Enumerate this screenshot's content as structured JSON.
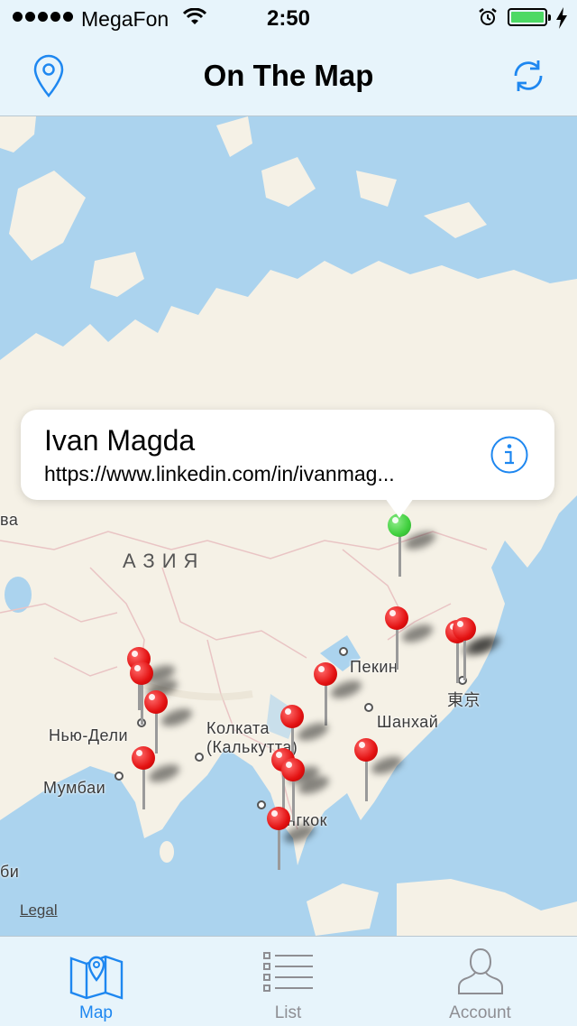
{
  "status_bar": {
    "carrier": "MegaFon",
    "time": "2:50",
    "battery_level": 1.0,
    "battery_color": "#4cd964",
    "icons": [
      "signal-dots",
      "wifi-icon",
      "alarm-icon",
      "battery-icon",
      "charging-bolt-icon"
    ]
  },
  "nav": {
    "title": "On The Map",
    "left_icon": "location-pin-icon",
    "right_icon": "refresh-icon",
    "accent": "#1e87f0"
  },
  "callout": {
    "name": "Ivan Magda",
    "url": "https://www.linkedin.com/in/ivanmag...",
    "icon": "info-icon"
  },
  "map": {
    "region_label": "АЗИЯ",
    "cities": {
      "beijing": "Пекин",
      "tokyo": "東京",
      "shanghai": "Шанхай",
      "delhi": "Нью-Дели",
      "kolkata_1": "Колката",
      "kolkata_2": "(Калькутта)",
      "mumbai": "Мумбаи",
      "bangkok": "нгкок",
      "edge_left_1": "ва",
      "edge_left_2": "би"
    },
    "legal": "Legal",
    "pin_colors": {
      "student": "#e31212",
      "selected": "#3fcf3d"
    }
  },
  "tabs": [
    {
      "label": "Map",
      "icon": "map-icon",
      "active": true
    },
    {
      "label": "List",
      "icon": "list-icon",
      "active": false
    },
    {
      "label": "Account",
      "icon": "account-icon",
      "active": false
    }
  ],
  "colors": {
    "active_tab": "#1e87f0",
    "inactive_tab": "#8e8e93",
    "water": "#abd3ee",
    "land": "#f5f1e6"
  }
}
